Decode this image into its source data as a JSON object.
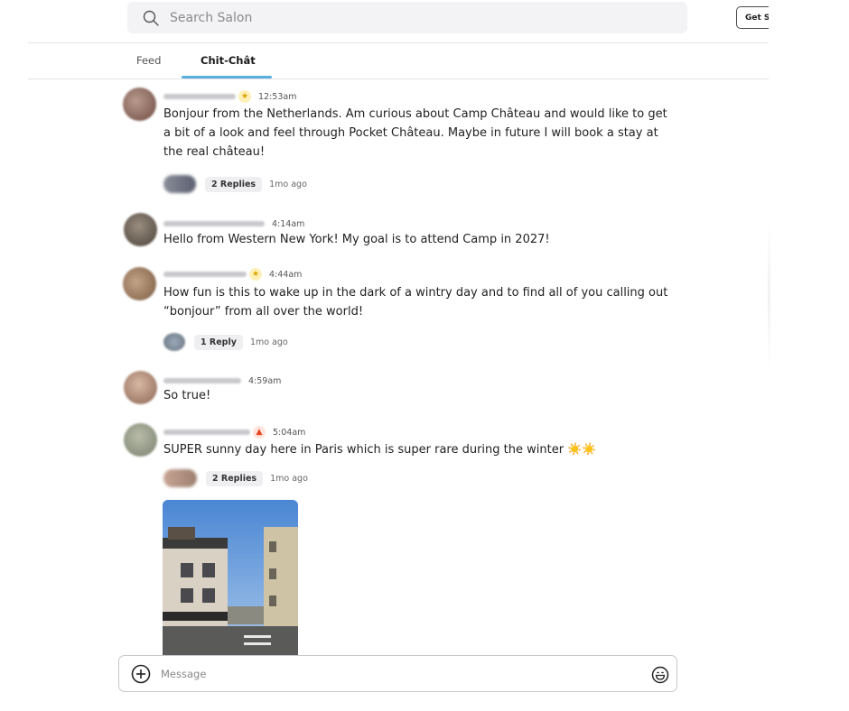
{
  "header": {
    "search_placeholder": "Search Salon",
    "get_button_label": "Get S"
  },
  "tabs": [
    {
      "label": "Feed",
      "active": false
    },
    {
      "label": "Chit-Chât",
      "active": true
    }
  ],
  "messages": [
    {
      "badge": "star",
      "time": "12:53am",
      "text": "Bonjour from the Netherlands. Am curious about Camp Château and would like to get a bit of a look and feel through Pocket Château. Maybe in future I will book a stay at the real château!",
      "replies_label": "2 Replies",
      "replies_ago": "1mo ago"
    },
    {
      "badge": "",
      "time": "4:14am",
      "text": "Hello from Western New York! My goal is to attend Camp in 2027!"
    },
    {
      "badge": "star",
      "time": "4:44am",
      "text": "How fun is this to wake up in the dark of a wintry day and to find all of you calling out “bonjour” from all over the world!",
      "replies_label": "1 Reply",
      "replies_ago": "1mo ago"
    },
    {
      "badge": "",
      "time": "4:59am",
      "text": "So true!"
    },
    {
      "badge": "fire",
      "time": "5:04am",
      "text": "SUPER sunny day here in Paris which is super rare during the winter ☀️☀️",
      "replies_label": "2 Replies",
      "replies_ago": "1mo ago",
      "has_photo": true
    }
  ],
  "composer": {
    "placeholder": "Message"
  },
  "icons": [
    "search-icon",
    "plus-circle-icon",
    "emoji-icon",
    "star-badge-icon",
    "fire-badge-icon"
  ],
  "colors": {
    "tab_underline": "#5aaee0",
    "search_bg": "#f3f3f5",
    "reply_pill_bg": "#efeff2"
  }
}
